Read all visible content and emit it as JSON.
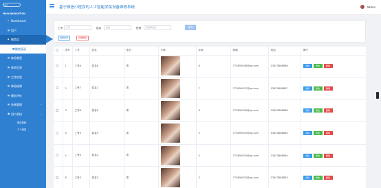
{
  "sidebar": {
    "logo_text": "logo",
    "nav_title": "MAIN NAVIGATION",
    "items": [
      {
        "label": "Dashboard",
        "icon": "home-icon"
      },
      {
        "label": "用户",
        "icon": "grid-icon"
      },
      {
        "label": "微商品",
        "icon": "tag-icon"
      },
      {
        "label": "微信阅读",
        "icon": "users-icon"
      },
      {
        "label": "体检类型",
        "icon": "grid-icon"
      },
      {
        "label": "体检信息",
        "icon": "grid-icon"
      },
      {
        "label": "工作信息",
        "icon": "grid-icon"
      },
      {
        "label": "体检结果",
        "icon": "grid-icon"
      },
      {
        "label": "服务评价",
        "icon": "grid-icon"
      },
      {
        "label": "系统管理",
        "icon": "grid-icon"
      },
      {
        "label": "用户资料",
        "icon": "user-icon"
      },
      {
        "label": "修改密码",
        "icon": ""
      },
      {
        "label": "个人信息",
        "icon": ""
      }
    ]
  },
  "header": {
    "title": "基于微信小程序的人工智能学院设备维修系统",
    "user": "admin"
  },
  "search": {
    "label_id": "工号",
    "placeholder_id": "工号",
    "label_name": "姓名",
    "placeholder_name": "姓名",
    "label_status": "性别",
    "placeholder_status": "请选择性别",
    "search_button": "查询",
    "add_button": "批量新增",
    "delete_button": "批量删除"
  },
  "table": {
    "headers": [
      "",
      "序号",
      "工号",
      "姓名",
      "性别",
      "头像",
      "年龄",
      "邮箱",
      "电话",
      "操作"
    ],
    "actions": {
      "view": "详情",
      "edit": "修改",
      "delete": "删除"
    },
    "rows": [
      {
        "index": "1",
        "id": "工号8",
        "name": "姓名8",
        "gender": "男",
        "age": "8",
        "email": "773890008@qq.com",
        "phone": "13823888888"
      },
      {
        "index": "2",
        "id": "工号7",
        "name": "姓名7",
        "gender": "男",
        "age": "7",
        "email": "773890007@qq.com",
        "phone": "13823888887"
      },
      {
        "index": "3",
        "id": "工号6",
        "name": "姓名6",
        "gender": "男",
        "age": "6",
        "email": "773890006@qq.com",
        "phone": "13823888886"
      },
      {
        "index": "4",
        "id": "工号5",
        "name": "姓名5",
        "gender": "男",
        "age": "5",
        "email": "773890005@qq.com",
        "phone": "13823888885"
      },
      {
        "index": "5",
        "id": "工号4",
        "name": "姓名4",
        "gender": "男",
        "age": "4",
        "email": "773890004@qq.com",
        "phone": "13823888884"
      },
      {
        "index": "6",
        "id": "工号3",
        "name": "姓名3",
        "gender": "男",
        "age": "3",
        "email": "773890003@qq.com",
        "phone": "13823888883"
      }
    ]
  },
  "colors": {
    "primary": "#2f80d1",
    "view": "#3a9bea",
    "edit": "#4cb84a",
    "delete": "#e24b4b"
  }
}
